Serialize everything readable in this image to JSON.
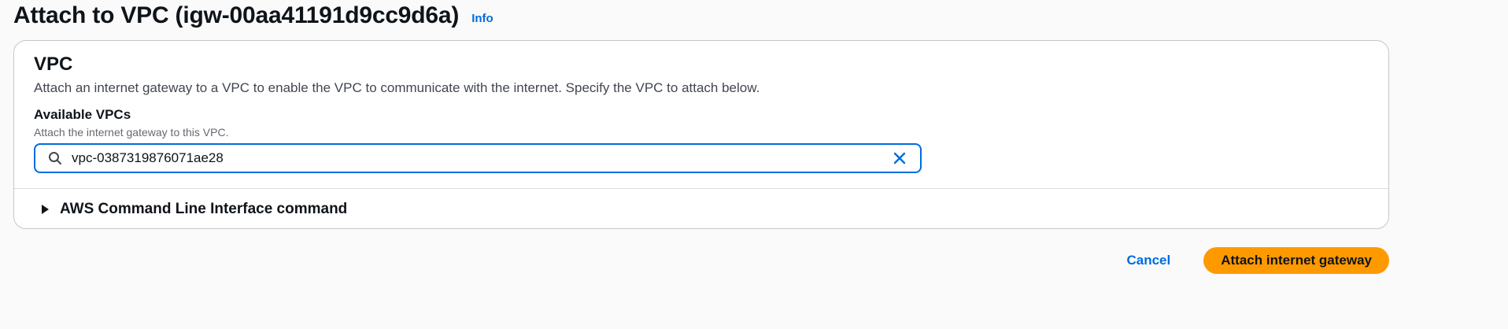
{
  "header": {
    "title": "Attach to VPC (igw-00aa41191d9cc9d6a)",
    "info_label": "Info"
  },
  "vpc_section": {
    "title": "VPC",
    "description": "Attach an internet gateway to a VPC to enable the VPC to communicate with the internet. Specify the VPC to attach below.",
    "field_label": "Available VPCs",
    "field_description": "Attach the internet gateway to this VPC.",
    "search_value": "vpc-0387319876071ae28",
    "search_icon": "search-icon",
    "clear_icon": "close-icon"
  },
  "cli_expander": {
    "label": "AWS Command Line Interface command",
    "expanded": false,
    "icon": "caret-right-icon"
  },
  "actions": {
    "cancel_label": "Cancel",
    "submit_label": "Attach internet gateway"
  },
  "colors": {
    "link": "#006ce0",
    "primary_button": "#ff9900",
    "input_focus_border": "#006ce0"
  }
}
